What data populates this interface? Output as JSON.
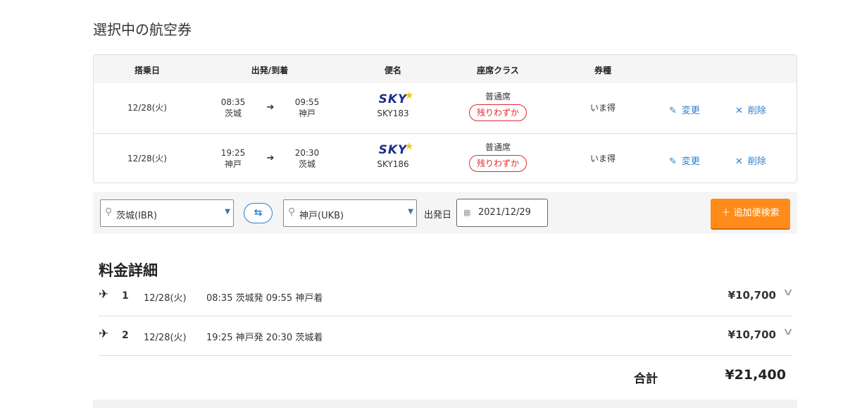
{
  "page": {
    "title": "選択中の航空券"
  },
  "table": {
    "headers": [
      "搭乗日",
      "出発/到着",
      "便名",
      "座席クラス",
      "券種"
    ],
    "rows": [
      {
        "date": "12/28(火)",
        "dep_time": "08:35",
        "dep_airport": "茨城",
        "arr_time": "09:55",
        "arr_airport": "神戸",
        "airline_logo": "SKY",
        "flight": "SKY183",
        "seat_class": "普通席",
        "badge": "残りわずか",
        "ticket": "いま得",
        "change": "変更",
        "delete": "削除"
      },
      {
        "date": "12/28(火)",
        "dep_time": "19:25",
        "dep_airport": "神戸",
        "arr_time": "20:30",
        "arr_airport": "茨城",
        "airline_logo": "SKY",
        "flight": "SKY186",
        "seat_class": "普通席",
        "badge": "残りわずか",
        "ticket": "いま得",
        "change": "変更",
        "delete": "削除"
      }
    ],
    "arrow_icon": "arrow-right-icon"
  },
  "search": {
    "from": "茨城(IBR)",
    "to": "神戸(UKB)",
    "date_label": "出発日",
    "date_value": "2021/12/29",
    "button": "＋ 追加便検索"
  },
  "fare": {
    "title": "料金詳細",
    "items": [
      {
        "num": "1",
        "date": "12/28(火)",
        "detail": "08:35 茨城発 09:55 神戸着",
        "price": "¥10,700"
      },
      {
        "num": "2",
        "date": "12/28(火)",
        "detail": "19:25 神戸発 20:30 茨城着",
        "price": "¥10,700"
      }
    ],
    "total_label": "合計",
    "total_value": "¥21,400"
  },
  "colors": {
    "accent": "#2e7fd1",
    "cta": "#ff8c1a",
    "alert": "#e6262b",
    "airline": "#1d2e8c"
  }
}
